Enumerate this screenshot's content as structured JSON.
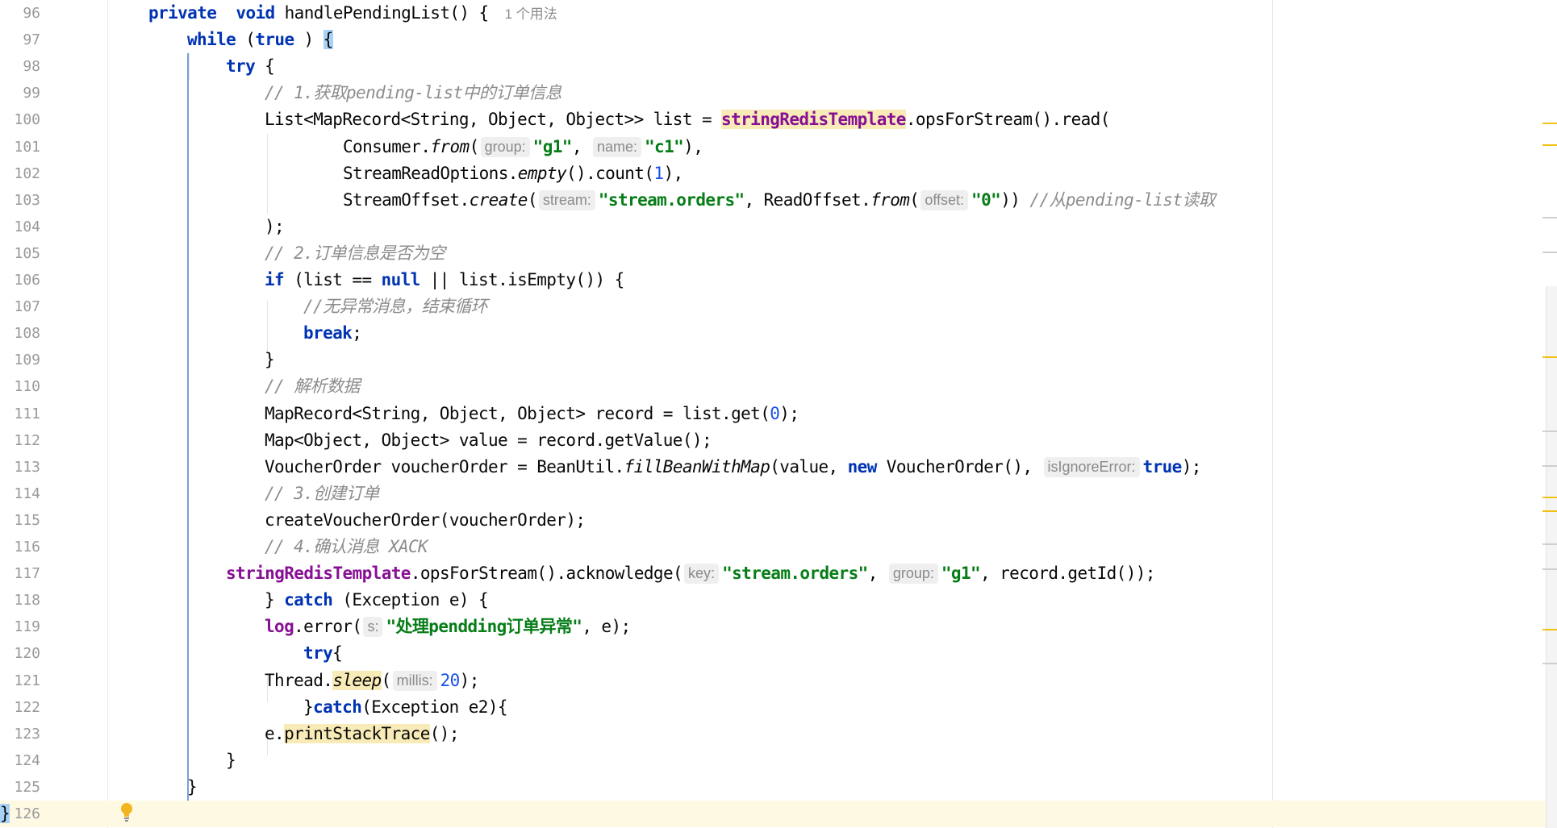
{
  "editor": {
    "lines": [
      {
        "num": "96",
        "tokens": [
          [
            "kw",
            "private"
          ],
          [
            "",
            "  "
          ],
          [
            "kw",
            "void"
          ],
          [
            "",
            " handlePendingList() { "
          ],
          [
            "usage",
            "1 个用法"
          ]
        ]
      },
      {
        "num": "97",
        "tokens": [
          [
            "kw",
            "while"
          ],
          [
            "",
            " ("
          ],
          [
            "kw",
            "true"
          ],
          [
            "",
            " ) "
          ],
          [
            "brace",
            "{"
          ]
        ]
      },
      {
        "num": "98",
        "tokens": [
          [
            "kw",
            "try"
          ],
          [
            "",
            " {"
          ]
        ]
      },
      {
        "num": "99",
        "tokens": [
          [
            "com",
            "// 1.获取pending-list中的订单信息"
          ]
        ]
      },
      {
        "num": "100",
        "tokens": [
          [
            "",
            "List<MapRecord<String, Object, Object>> list = "
          ],
          [
            "fldhl",
            "stringRedisTemplate"
          ],
          [
            "",
            ".opsForStream().read("
          ]
        ]
      },
      {
        "num": "101",
        "tokens": [
          [
            "",
            "Consumer."
          ],
          [
            "sfn",
            "from"
          ],
          [
            "",
            "("
          ],
          [
            "hint",
            "group:"
          ],
          [
            "str",
            "\"g1\""
          ],
          [
            "",
            ", "
          ],
          [
            "hint",
            "name:"
          ],
          [
            "str",
            "\"c1\""
          ],
          [
            "",
            "),"
          ]
        ]
      },
      {
        "num": "102",
        "tokens": [
          [
            "",
            "StreamReadOptions."
          ],
          [
            "sfn",
            "empty"
          ],
          [
            "",
            "().count("
          ],
          [
            "num",
            "1"
          ],
          [
            "",
            "),"
          ]
        ]
      },
      {
        "num": "103",
        "tokens": [
          [
            "",
            "StreamOffset."
          ],
          [
            "sfn",
            "create"
          ],
          [
            "",
            "("
          ],
          [
            "hint",
            "stream:"
          ],
          [
            "str",
            "\"stream.orders\""
          ],
          [
            "",
            ", ReadOffset."
          ],
          [
            "sfn",
            "from"
          ],
          [
            "",
            "("
          ],
          [
            "hint",
            "offset:"
          ],
          [
            "str",
            "\"0\""
          ],
          [
            "",
            ")) "
          ],
          [
            "com",
            "//从pending-list读取"
          ]
        ]
      },
      {
        "num": "104",
        "tokens": [
          [
            "",
            ");"
          ]
        ]
      },
      {
        "num": "105",
        "tokens": [
          [
            "com",
            "// 2.订单信息是否为空"
          ]
        ]
      },
      {
        "num": "106",
        "tokens": [
          [
            "kw",
            "if"
          ],
          [
            "",
            " (list == "
          ],
          [
            "kw",
            "null"
          ],
          [
            "",
            " || list.isEmpty()) {"
          ]
        ]
      },
      {
        "num": "107",
        "tokens": [
          [
            "com",
            "//无异常消息，结束循环"
          ]
        ]
      },
      {
        "num": "108",
        "tokens": [
          [
            "kw",
            "break"
          ],
          [
            "",
            ";"
          ]
        ]
      },
      {
        "num": "109",
        "tokens": [
          [
            "",
            "}"
          ]
        ]
      },
      {
        "num": "110",
        "tokens": [
          [
            "com",
            "// 解析数据"
          ]
        ]
      },
      {
        "num": "111",
        "tokens": [
          [
            "",
            "MapRecord<String, Object, Object> record = list.get("
          ],
          [
            "num",
            "0"
          ],
          [
            "",
            ");"
          ]
        ]
      },
      {
        "num": "112",
        "tokens": [
          [
            "",
            "Map<Object, Object> value = record.getValue();"
          ]
        ]
      },
      {
        "num": "113",
        "tokens": [
          [
            "",
            "VoucherOrder voucherOrder = BeanUtil."
          ],
          [
            "sfn",
            "fillBeanWithMap"
          ],
          [
            "",
            "(value, "
          ],
          [
            "kw",
            "new"
          ],
          [
            "",
            " VoucherOrder(), "
          ],
          [
            "hint",
            "isIgnoreError:"
          ],
          [
            "kw",
            "true"
          ],
          [
            "",
            ");"
          ]
        ]
      },
      {
        "num": "114",
        "tokens": [
          [
            "com",
            "// 3.创建订单"
          ]
        ]
      },
      {
        "num": "115",
        "tokens": [
          [
            "",
            "createVoucherOrder(voucherOrder);"
          ]
        ]
      },
      {
        "num": "116",
        "tokens": [
          [
            "com",
            "// 4.确认消息 XACK"
          ]
        ]
      },
      {
        "num": "117",
        "tokens": [
          [
            "fld",
            "stringRedisTemplate"
          ],
          [
            "",
            ".opsForStream().acknowledge("
          ],
          [
            "hint",
            "key:"
          ],
          [
            "str",
            "\"stream.orders\""
          ],
          [
            "",
            ", "
          ],
          [
            "hint",
            "group:"
          ],
          [
            "str",
            "\"g1\""
          ],
          [
            "",
            ", record.getId());"
          ]
        ]
      },
      {
        "num": "118",
        "tokens": [
          [
            "",
            "} "
          ],
          [
            "kw",
            "catch"
          ],
          [
            "",
            " (Exception e) {"
          ]
        ]
      },
      {
        "num": "119",
        "tokens": [
          [
            "fld",
            "log"
          ],
          [
            "",
            ".error("
          ],
          [
            "hint",
            "s:"
          ],
          [
            "str",
            "\"处理pendding订单异常\""
          ],
          [
            "",
            ", e);"
          ]
        ]
      },
      {
        "num": "120",
        "tokens": [
          [
            "kw",
            "try"
          ],
          [
            "",
            "{"
          ]
        ]
      },
      {
        "num": "121",
        "tokens": [
          [
            "",
            "Thread."
          ],
          [
            "sfnhl",
            "sleep"
          ],
          [
            "",
            "("
          ],
          [
            "hint",
            "millis:"
          ],
          [
            "num",
            "20"
          ],
          [
            "",
            ");"
          ]
        ]
      },
      {
        "num": "122",
        "tokens": [
          [
            "",
            "}"
          ],
          [
            "kw",
            "catch"
          ],
          [
            "",
            "(Exception e2){"
          ]
        ]
      },
      {
        "num": "123",
        "tokens": [
          [
            "",
            "e."
          ],
          [
            "hlonly",
            "printStackTrace"
          ],
          [
            "",
            "();"
          ]
        ]
      },
      {
        "num": "124",
        "tokens": [
          [
            "",
            "}"
          ]
        ]
      },
      {
        "num": "125",
        "tokens": [
          [
            "",
            "}"
          ]
        ]
      },
      {
        "num": "126",
        "tokens": [
          [
            "brace",
            "}"
          ]
        ]
      }
    ],
    "current_line": "126",
    "icons": [
      "lightbulb-icon"
    ]
  }
}
